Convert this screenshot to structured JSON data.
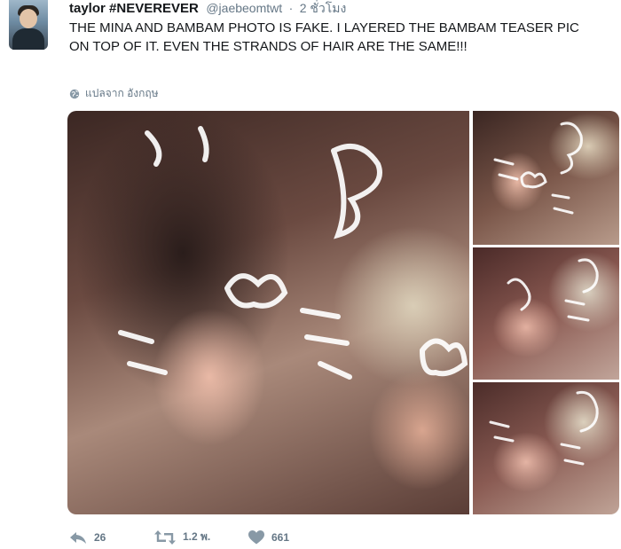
{
  "tweet": {
    "display_name": "taylor #NEVEREVER",
    "handle": "@jaebeomtwt",
    "separator": "·",
    "time": "2 ชั่วโมง",
    "text": "THE MINA AND BAMBAM PHOTO IS FAKE. I LAYERED THE BAMBAM TEASER PIC ON TOP OF IT. EVEN THE STRANDS OF HAIR ARE THE SAME!!!",
    "translate_label": "แปลจาก อังกฤษ"
  },
  "actions": {
    "reply_count": "26",
    "retweet_count": "1.2 พ.",
    "like_count": "661"
  },
  "colors": {
    "text": "#14171a",
    "muted": "#657786",
    "icon": "#8899a6"
  }
}
